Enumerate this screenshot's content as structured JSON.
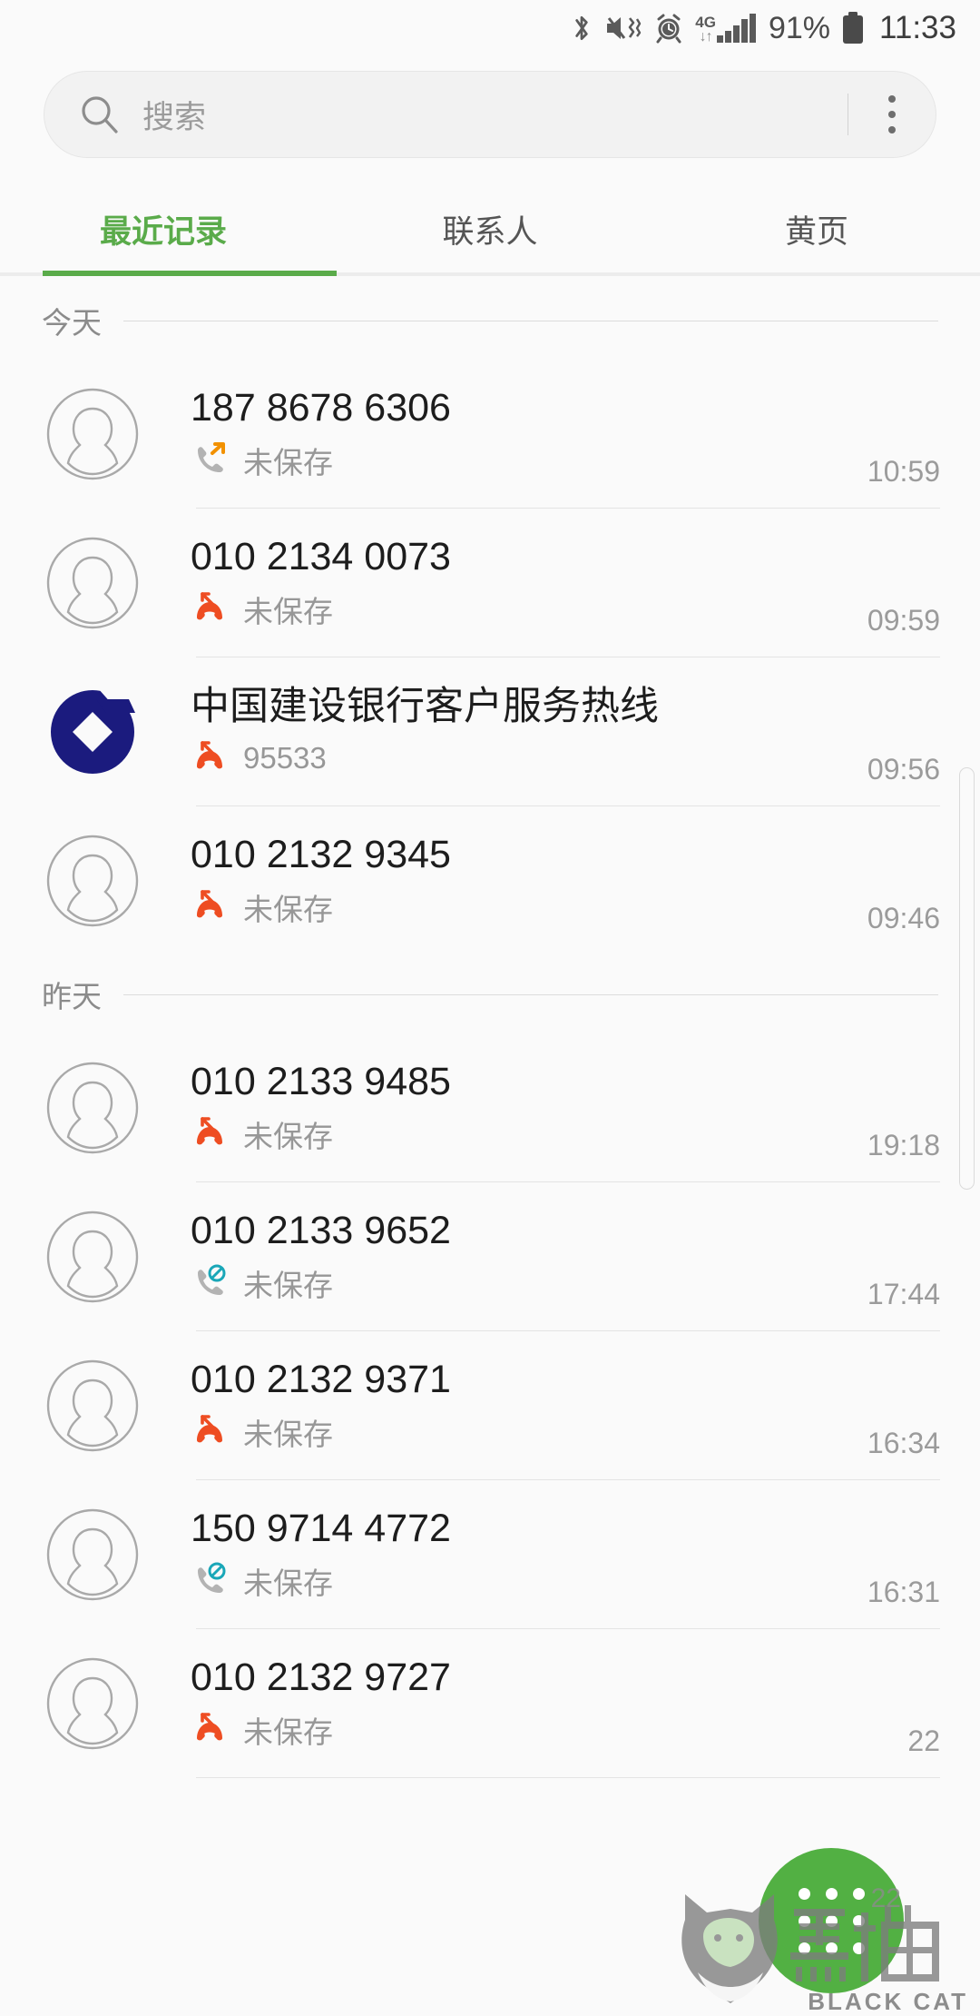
{
  "status_bar": {
    "bluetooth_icon": "bluetooth-icon",
    "mute_vibrate_icon": "mute-vibrate-icon",
    "alarm_icon": "alarm-icon",
    "network_type": "4G",
    "network_arrows": "↓↑",
    "signal_icon": "signal-bars-icon",
    "battery_percent": "91%",
    "battery_icon": "battery-icon",
    "time": "11:33"
  },
  "search": {
    "placeholder": "搜索",
    "icon": "search-icon",
    "overflow_icon": "more-vertical-icon"
  },
  "tabs": {
    "active_index": 0,
    "items": [
      {
        "label": "最近记录"
      },
      {
        "label": "联系人"
      },
      {
        "label": "黄页"
      }
    ]
  },
  "accent_color": "#5aab4a",
  "missed_call_color": "#ee4d22",
  "outgoing_call_color": "#f29100",
  "blocked_call_color": "#1aa7b8",
  "bank_logo_color": "#1b1b7e",
  "sections": [
    {
      "label": "今天",
      "calls": [
        {
          "avatar": "person-placeholder-avatar",
          "title": "187 8678 6306",
          "type_icon": "outgoing-call-icon",
          "subtitle": "未保存",
          "time": "10:59"
        },
        {
          "avatar": "person-placeholder-avatar",
          "title": "010 2134 0073",
          "type_icon": "missed-call-icon",
          "subtitle": "未保存",
          "time": "09:59"
        },
        {
          "avatar": "ccb-bank-logo",
          "title": "中国建设银行客户服务热线",
          "type_icon": "missed-call-icon",
          "subtitle": "95533",
          "time": "09:56"
        },
        {
          "avatar": "person-placeholder-avatar",
          "title": "010 2132 9345",
          "type_icon": "missed-call-icon",
          "subtitle": "未保存",
          "time": "09:46"
        }
      ]
    },
    {
      "label": "昨天",
      "calls": [
        {
          "avatar": "person-placeholder-avatar",
          "title": "010 2133 9485",
          "type_icon": "missed-call-icon",
          "subtitle": "未保存",
          "time": "19:18"
        },
        {
          "avatar": "person-placeholder-avatar",
          "title": "010 2133 9652",
          "type_icon": "blocked-call-icon",
          "subtitle": "未保存",
          "time": "17:44"
        },
        {
          "avatar": "person-placeholder-avatar",
          "title": "010 2132 9371",
          "type_icon": "missed-call-icon",
          "subtitle": "未保存",
          "time": "16:34"
        },
        {
          "avatar": "person-placeholder-avatar",
          "title": "150 9714 4772",
          "type_icon": "blocked-call-icon",
          "subtitle": "未保存",
          "time": "16:31"
        },
        {
          "avatar": "person-placeholder-avatar",
          "title": "010 2132 9727",
          "type_icon": "missed-call-icon",
          "subtitle": "未保存",
          "time": "22"
        }
      ]
    }
  ],
  "fab": {
    "icon": "dialpad-icon"
  },
  "watermark": {
    "brand": "BLACK CAT",
    "badge": "22",
    "logo": "black-cat-logo"
  }
}
